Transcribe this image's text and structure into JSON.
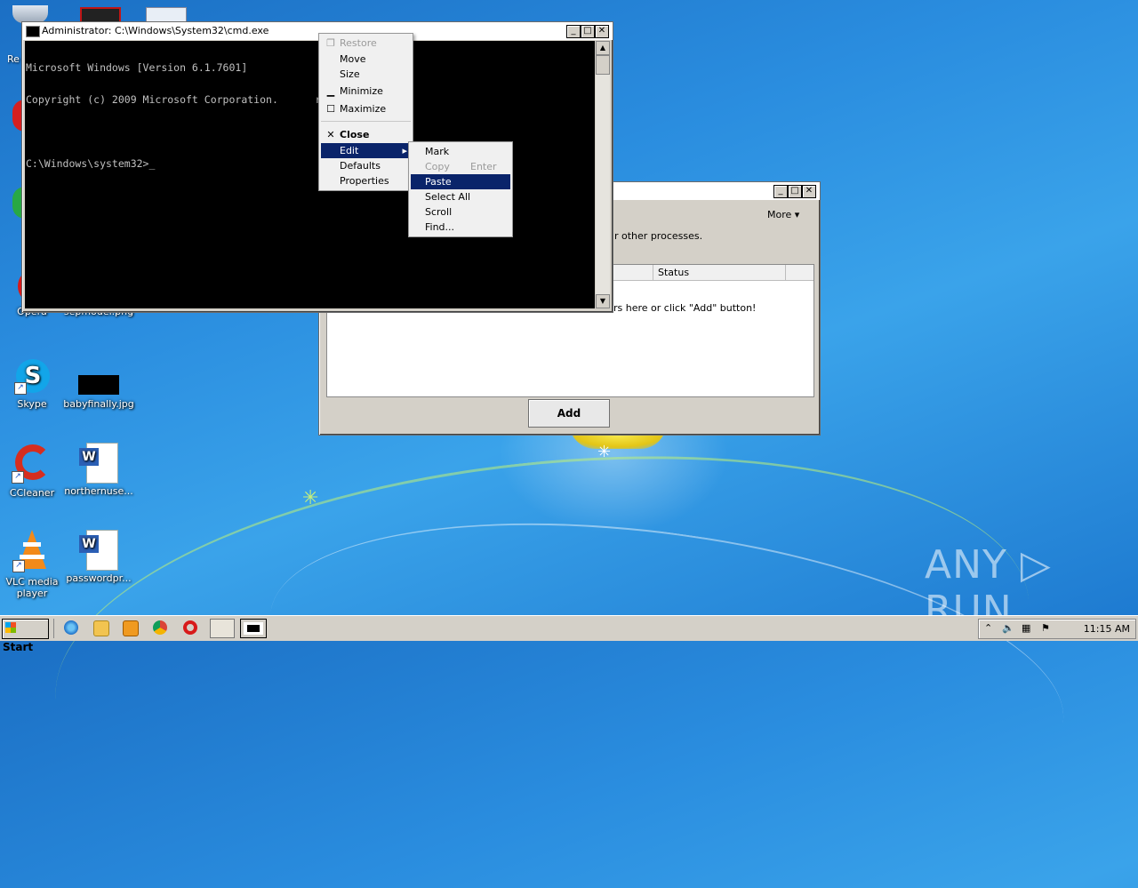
{
  "cmd_window": {
    "title": "Administrator: C:\\Windows\\System32\\cmd.exe",
    "lines": [
      "Microsoft Windows [Version 6.1.7601]",
      "Copyright (c) 2009 Microsoft Corporation.      reserved.",
      "",
      "C:\\Windows\\system32>_"
    ]
  },
  "system_menu": {
    "items": [
      {
        "label": "Restore",
        "icon": "restore-icon",
        "state": "disabled"
      },
      {
        "label": "Move",
        "icon": "",
        "state": "normal"
      },
      {
        "label": "Size",
        "icon": "",
        "state": "normal"
      },
      {
        "label": "Minimize",
        "icon": "minimize-icon",
        "state": "normal"
      },
      {
        "label": "Maximize",
        "icon": "maximize-icon",
        "state": "normal"
      },
      {
        "label": "Close",
        "icon": "close-icon",
        "state": "bold"
      },
      {
        "label": "Edit",
        "icon": "submenu-arrow-icon",
        "state": "selected"
      },
      {
        "label": "Defaults",
        "icon": "",
        "state": "normal"
      },
      {
        "label": "Properties",
        "icon": "",
        "state": "normal"
      }
    ]
  },
  "edit_submenu": {
    "items": [
      {
        "label": "Mark",
        "shortcut": "",
        "state": "normal"
      },
      {
        "label": "Copy",
        "shortcut": "Enter",
        "state": "disabled"
      },
      {
        "label": "Paste",
        "shortcut": "",
        "state": "selected"
      },
      {
        "label": "Select All",
        "shortcut": "",
        "state": "normal"
      },
      {
        "label": "Scroll",
        "shortcut": "",
        "state": "normal"
      },
      {
        "label": "Find...",
        "shortcut": "",
        "state": "normal"
      }
    ]
  },
  "back_window": {
    "more_label": "More",
    "desc_fragment": "r other processes.",
    "column_status": "Status",
    "empty_hint": "rs here or click \"Add\" button!",
    "add_button": "Add"
  },
  "desktop_icons": [
    {
      "label": "Opera",
      "icon": "opera-icon"
    },
    {
      "label": "sepmodel.png",
      "icon": "image-file-icon"
    },
    {
      "label": "Skype",
      "icon": "skype-icon"
    },
    {
      "label": "babyfinally.jpg",
      "icon": "image-file-icon"
    },
    {
      "label": "CCleaner",
      "icon": "ccleaner-icon"
    },
    {
      "label": "northernuse...",
      "icon": "word-doc-icon"
    },
    {
      "label": "VLC media player",
      "icon": "vlc-icon"
    },
    {
      "label": "passwordpr...",
      "icon": "word-doc-icon"
    }
  ],
  "partial_icon_labels": {
    "top_left": "Re"
  },
  "taskbar": {
    "start_label": "Start",
    "clock": "11:15 AM",
    "pinned": [
      "ie-icon",
      "explorer-icon",
      "media-player-icon",
      "chrome-icon",
      "opera-icon",
      "network-app-icon",
      "cmd-icon"
    ]
  },
  "watermark": "ANY ▷ RUN"
}
